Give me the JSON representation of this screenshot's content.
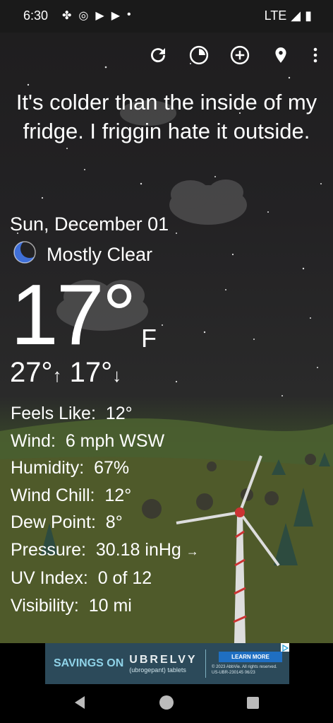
{
  "status_bar": {
    "time": "6:30",
    "network": "LTE"
  },
  "quote": "It's colder than the inside of my fridge. I friggin hate it outside.",
  "date": "Sun, December 01",
  "condition": "Mostly Clear",
  "temperature": "17°",
  "unit": "F",
  "high": "27°",
  "low": "17°",
  "details": [
    {
      "label": "Feels Like:",
      "value": "12°"
    },
    {
      "label": "Wind:",
      "value": "6 mph WSW"
    },
    {
      "label": "Humidity:",
      "value": "67%"
    },
    {
      "label": "Wind Chill:",
      "value": "12°"
    },
    {
      "label": "Dew Point:",
      "value": "8°"
    },
    {
      "label": "Pressure:",
      "value": "30.18 inHg",
      "trend": "→"
    },
    {
      "label": "UV Index:",
      "value": "0 of 12"
    },
    {
      "label": "Visibility:",
      "value": "10 mi"
    }
  ],
  "ad": {
    "savings": "SAVINGS ON",
    "brand": "UBRELVY",
    "brand_sub": "(ubrogepant) tablets",
    "cta": "LEARN MORE",
    "legal_1": "© 2023 AbbVie. All rights reserved.",
    "legal_2": "US-UBR-230145 06/23"
  },
  "icons": {
    "refresh": "refresh-icon",
    "radar": "radar-icon",
    "add_location": "add-location-icon",
    "location": "location-pin-icon",
    "more": "more-vert-icon",
    "condition": "crescent-moon-icon"
  }
}
